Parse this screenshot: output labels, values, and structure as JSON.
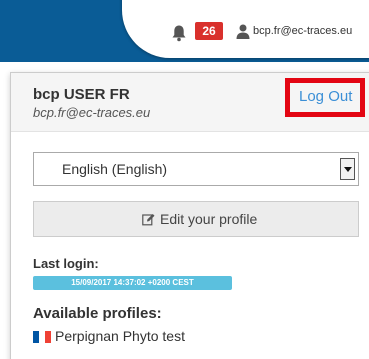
{
  "header": {
    "notification_count": "26",
    "user_email": "bcp.fr@ec-traces.eu",
    "colors": {
      "topbar": "#0a5c96",
      "badge": "#d9302c"
    }
  },
  "user_menu": {
    "name": "bcp USER FR",
    "email": "bcp.fr@ec-traces.eu",
    "logout_label": "Log Out",
    "language": {
      "selected": "English (English)"
    },
    "edit_profile_label": "Edit your profile",
    "last_login": {
      "title": "Last login:",
      "value": "15/09/2017 14:37:02 +0200 CEST"
    },
    "profiles": {
      "title": "Available profiles:",
      "items": [
        {
          "label": "Perpignan Phyto test",
          "flag": "fr-flag-icon"
        }
      ]
    }
  },
  "icons": {
    "bell": "bell-icon",
    "user": "user-icon",
    "edit": "edit-icon",
    "flag": "fr-flag-icon"
  },
  "accent_colors": {
    "link": "#3b8fd6",
    "highlight": "#e30613",
    "login_badge": "#5bc0de"
  }
}
